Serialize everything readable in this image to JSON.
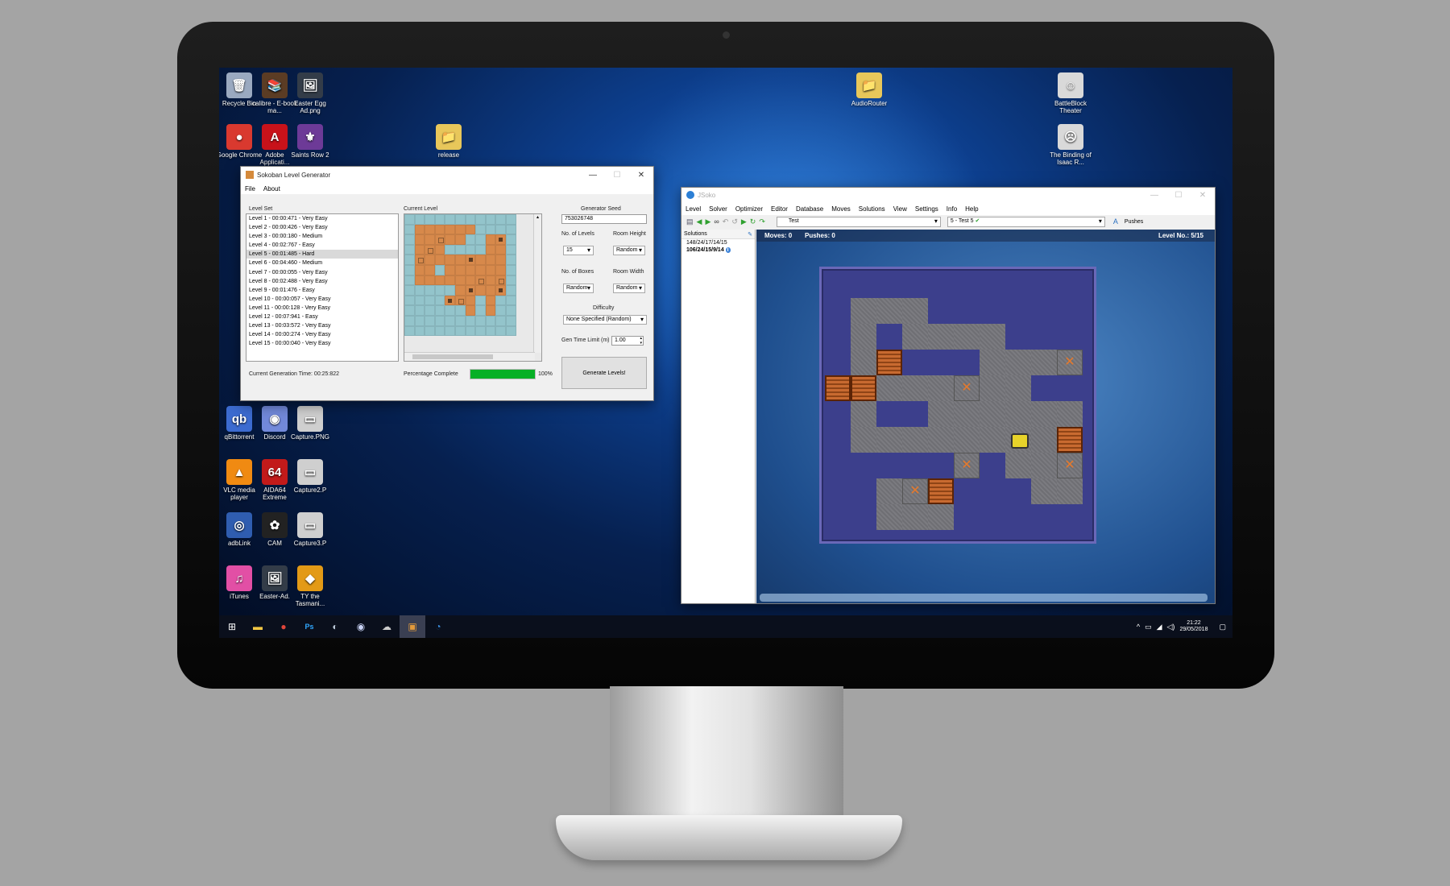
{
  "desktop": {
    "icons": [
      {
        "label": "Recycle Bin",
        "glyph": "🗑",
        "color": "#9aa9c0"
      },
      {
        "label": "calibre - E-book ma...",
        "glyph": "📚",
        "color": "#5b3c24"
      },
      {
        "label": "Easter Egg Ad.png",
        "glyph": "🖼",
        "color": "#333c48"
      },
      {
        "label": "Google Chrome",
        "glyph": "●",
        "color": "#d9392f"
      },
      {
        "label": "Adobe Applicati...",
        "glyph": "A",
        "color": "#c8121a"
      },
      {
        "label": "Saints Row 2",
        "glyph": "⚜",
        "color": "#6d3a97"
      },
      {
        "label": "release",
        "glyph": "📁",
        "color": "#e8c75a"
      },
      {
        "label": "AudioRouter",
        "glyph": "📁",
        "color": "#e8c75a"
      },
      {
        "label": "BattleBlock Theater",
        "glyph": "☺",
        "color": "#d9d9d9"
      },
      {
        "label": "The Binding of Isaac R...",
        "glyph": "☹",
        "color": "#d9d9d9"
      },
      {
        "label": "qBittorrent",
        "glyph": "qb",
        "color": "#3c6bd0"
      },
      {
        "label": "Discord",
        "glyph": "◉",
        "color": "#7289da"
      },
      {
        "label": "Capture.PNG",
        "glyph": "▭",
        "color": "#cfcfcf"
      },
      {
        "label": "VLC media player",
        "glyph": "▲",
        "color": "#f08a12"
      },
      {
        "label": "AIDA64 Extreme",
        "glyph": "64",
        "color": "#c21a1a"
      },
      {
        "label": "Capture2.P",
        "glyph": "▭",
        "color": "#cfcfcf"
      },
      {
        "label": "adbLink",
        "glyph": "◎",
        "color": "#2f5db0"
      },
      {
        "label": "CAM",
        "glyph": "✿",
        "color": "#222222"
      },
      {
        "label": "Capture3.P",
        "glyph": "▭",
        "color": "#cfcfcf"
      },
      {
        "label": "iTunes",
        "glyph": "♫",
        "color": "#e24fa5"
      },
      {
        "label": "Easter-Ad.",
        "glyph": "🖼",
        "color": "#333c48"
      },
      {
        "label": "TY the Tasmani...",
        "glyph": "◆",
        "color": "#e39a16"
      }
    ]
  },
  "generator": {
    "title": "Sokoban Level Generator",
    "menu": [
      "File",
      "About"
    ],
    "level_set_label": "Level Set",
    "levels": [
      "Level 1 - 00:00:471 - Very Easy",
      "Level 2 - 00:00:426 - Very Easy",
      "Level 3 - 00:00:180 - Medium",
      "Level 4 - 00:02:767 - Easy",
      "Level 5 - 00:01:485 - Hard",
      "Level 6 - 00:04:460 - Medium",
      "Level 7 - 00:00:055 - Very Easy",
      "Level 8 - 00:02:488 - Very Easy",
      "Level 9 - 00:01:476 - Easy",
      "Level 10 - 00:00:057 - Very Easy",
      "Level 11 - 00:00:128 - Very Easy",
      "Level 12 - 00:07:941 - Easy",
      "Level 13 - 00:03:572 - Very Easy",
      "Level 14 - 00:00:274 - Very Easy",
      "Level 15 - 00:00:040 - Very Easy"
    ],
    "selected_index": 4,
    "current_level_label": "Current Level",
    "generator_seed_label": "Generator Seed",
    "generator_seed": "753026748",
    "num_levels_label": "No. of Levels",
    "num_levels": "15",
    "room_height_label": "Room Height",
    "room_height": "Random",
    "num_boxes_label": "No. of Boxes",
    "num_boxes": "Random",
    "room_width_label": "Room Width",
    "room_width": "Random",
    "difficulty_label": "Difficulty",
    "difficulty": "None Specified (Random)",
    "gen_time_label": "Gen Time Limit (m)",
    "gen_time": "1.00",
    "generation_time": "Current Generation Time: 00:25:822",
    "percentage_label": "Percentage Complete",
    "percentage_text": "100%",
    "progress": 1.0,
    "generate_button": "Generate Levels!",
    "preview_rows": [
      "wwwwwwwwwww",
      "wffffffwwww",
      "wffgffwwfbw",
      "wfgfwwwwffw",
      "wgffffbfffw",
      "wffwffffffw",
      "wffffffgfgw",
      "wwwwwfbffbw",
      "wwwwbgfwfww",
      "wwwwwwfwfww",
      "wwwwwwwwwww",
      "wwwwwwwwwww"
    ]
  },
  "jsoko": {
    "title": "JSoko",
    "menu": [
      "Level",
      "Solver",
      "Optimizer",
      "Editor",
      "Database",
      "Moves",
      "Solutions",
      "View",
      "Settings",
      "Info",
      "Help"
    ],
    "collection_select": "Test",
    "level_select": "5 - Test 5",
    "pushes_label": "Pushes",
    "solutions_label": "Solutions",
    "solutions": [
      "148/24/17/14/15",
      "106/24/15/9/14"
    ],
    "moves_text": "Moves: 0",
    "pushes_text": "Pushes: 0",
    "level_number": "Level No.: 5/15",
    "board_rows": [
      "WWWWWWWWWWW",
      "WFFFWWWWWWW",
      "WFWFFFFWWWW",
      "WFBWWWFFFGW",
      "BBFFFGFFWWW",
      "WFWWFFFFFFW",
      "WFFFFFFPFBW",
      "WWWWWGWFFGW",
      "WWFGBWWWFFW",
      "WWFFFWWWWWW",
      "WWWWWWWWWWW"
    ]
  },
  "taskbar": {
    "time": "21:22",
    "date": "29/05/2018",
    "icons": [
      "start-icon",
      "file-explorer-icon",
      "chrome-icon",
      "photoshop-icon",
      "steam-icon",
      "discord-icon",
      "steam-link-icon",
      "sokoban-generator-icon",
      "jsoko-icon"
    ]
  }
}
